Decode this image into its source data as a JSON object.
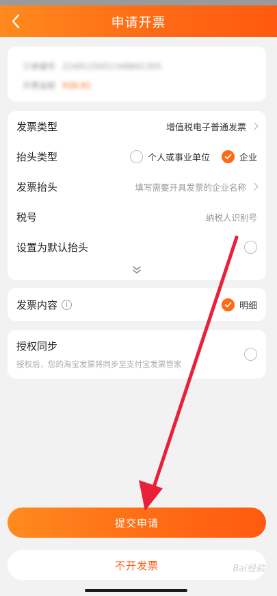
{
  "header": {
    "title": "申请开票"
  },
  "order": {
    "number_label": "订单编号",
    "number_value": "2249125051348841305",
    "amount_label": "开票金额",
    "amount_value": "¥26.91"
  },
  "form": {
    "invoice_type": {
      "label": "发票类型",
      "value": "增值税电子普通发票"
    },
    "title_type": {
      "label": "抬头类型",
      "options": [
        "个人或事业单位",
        "企业"
      ],
      "selected": "企业"
    },
    "invoice_title": {
      "label": "发票抬头",
      "placeholder": "填写需要开具发票的企业名称"
    },
    "tax_id": {
      "label": "税号",
      "placeholder": "纳税人识别号"
    },
    "default_title": {
      "label": "设置为默认抬头",
      "checked": false
    }
  },
  "content": {
    "label": "发票内容",
    "option": "明细",
    "selected": true
  },
  "auth": {
    "title": "授权同步",
    "description": "授权后，您的淘宝发票将同步至支付宝发票管家",
    "checked": false
  },
  "buttons": {
    "submit": "提交申请",
    "no_invoice": "不开发票"
  },
  "watermark": "Bai经验",
  "colors": {
    "accent": "#ff6a14",
    "accent_light": "#ff8a1e",
    "arrow": "#e8203a"
  }
}
